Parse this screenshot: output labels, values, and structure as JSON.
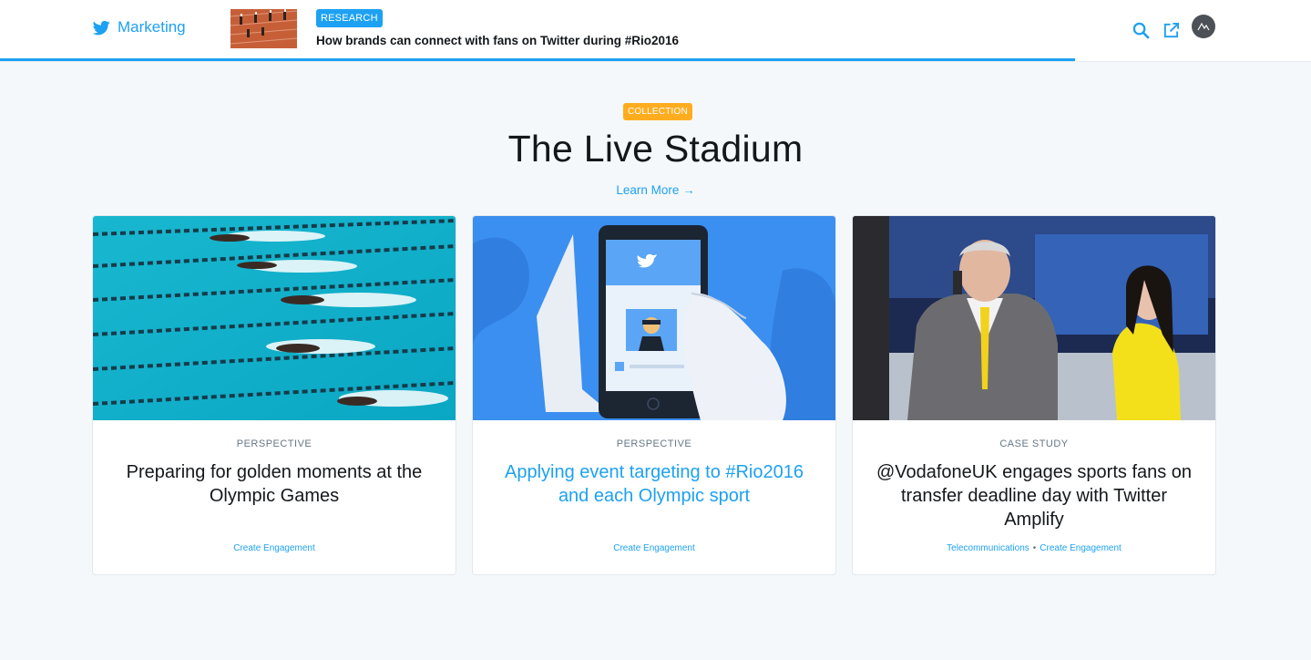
{
  "header": {
    "brand_label": "Marketing",
    "badge": "RESEARCH",
    "article_title": "How brands can connect with fans on Twitter during #Rio2016",
    "progress_pct": 82
  },
  "hero": {
    "badge": "COLLECTION",
    "title": "The Live Stadium",
    "learn_more": "Learn More →"
  },
  "cards": [
    {
      "kicker": "PERSPECTIVE",
      "title": "Preparing for golden moments at the Olympic Games",
      "tags": [
        "Create Engagement"
      ]
    },
    {
      "kicker": "PERSPECTIVE",
      "title": "Applying event targeting to #Rio2016 and each Olympic sport",
      "tags": [
        "Create Engagement"
      ]
    },
    {
      "kicker": "CASE STUDY",
      "title": "@VodafoneUK engages sports fans on transfer deadline day with Twitter Amplify",
      "tags": [
        "Telecommunications",
        "Create Engagement"
      ]
    }
  ],
  "colors": {
    "accent": "#1da1f2",
    "collection_badge": "#ffad1f",
    "text": "#14171a",
    "muted": "#657786"
  },
  "icons": [
    "twitter-bird-icon",
    "search-icon",
    "external-link-icon",
    "avatar-icon"
  ]
}
